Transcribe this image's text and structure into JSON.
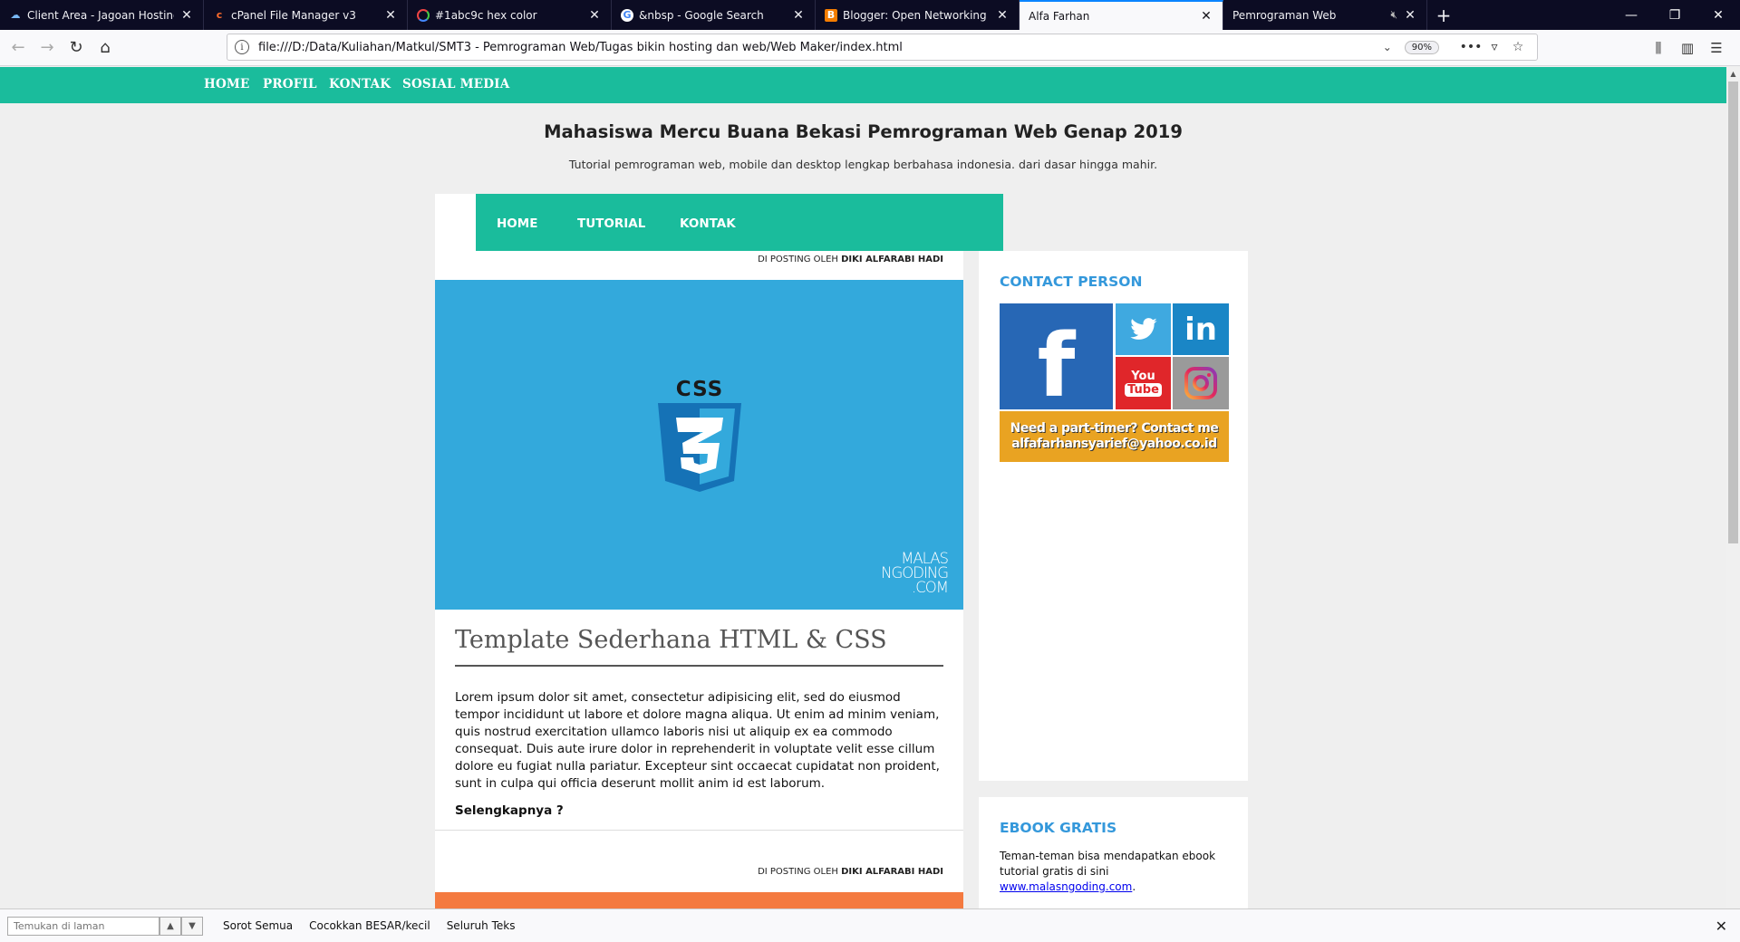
{
  "browser": {
    "tabs": [
      {
        "title": "Client Area - Jagoan Hosting Indon",
        "favicon": "cloud-icon",
        "active": false
      },
      {
        "title": "cPanel File Manager v3",
        "favicon": "cpanel-icon",
        "active": false
      },
      {
        "title": "#1abc9c hex color",
        "favicon": "color-wheel-icon",
        "active": false
      },
      {
        "title": "&nbsp - Google Search",
        "favicon": "google-icon",
        "active": false
      },
      {
        "title": "Blogger: Open Networking - Ta",
        "favicon": "blogger-icon",
        "active": false
      },
      {
        "title": "Alfa Farhan",
        "favicon": "",
        "active": true
      },
      {
        "title": "Pemrograman Web",
        "favicon": "",
        "active": false
      }
    ],
    "new_tab_label": "+",
    "url": "file:///D:/Data/Kuliahan/Matkul/SMT3 - Pemrograman Web/Tugas bikin hosting dan web/Web Maker/index.html",
    "zoom": "90%"
  },
  "page": {
    "top_nav": [
      "HOME",
      "PROFIL",
      "KONTAK",
      "SOSIAL MEDIA"
    ],
    "site_title": "Mahasiswa Mercu Buana Bekasi Pemrograman Web Genap 2019",
    "site_description": "Tutorial pemrograman web, mobile dan desktop lengkap berbahasa indonesia. dari dasar hingga mahir.",
    "main_nav": [
      "HOME",
      "TUTORIAL",
      "KONTAK"
    ],
    "posts": [
      {
        "byline_prefix": "DI POSTING OLEH",
        "author": "DIKI ALFARABI HADI",
        "image_logo_text": "CSS",
        "watermark": [
          "MALAS",
          "NGODING",
          ".COM"
        ],
        "title": "Template Sederhana HTML & CSS",
        "body": "Lorem ipsum dolor sit amet, consectetur adipisicing elit, sed do eiusmod tempor incididunt ut labore et dolore magna aliqua. Ut enim ad minim veniam, quis nostrud exercitation ullamco laboris nisi ut aliquip ex ea commodo consequat. Duis aute irure dolor in reprehenderit in voluptate velit esse cillum dolore eu fugiat nulla pariatur. Excepteur sint occaecat cupidatat non proident, sunt in culpa qui officia deserunt mollit anim id est laborum.",
        "read_more": "Selengkapnya ?"
      },
      {
        "byline_prefix": "DI POSTING OLEH",
        "author": "DIKI ALFARABI HADI"
      }
    ],
    "sidebar": {
      "contact_title": "CONTACT PERSON",
      "social": {
        "facebook": "f",
        "linkedin": "in",
        "youtube": [
          "You",
          "Tube"
        ],
        "contact_lines": [
          "Need a part-timer? Contact me",
          "alfafarhansyarief@yahoo.co.id"
        ]
      },
      "ebook_title": "EBOOK GRATIS",
      "ebook_text": "Teman-teman bisa mendapatkan ebook tutorial gratis di sini",
      "ebook_link": "www.malasngoding.com",
      "ebook_after": "."
    },
    "colors": {
      "accent": "#1abc9c",
      "link_title": "#3498db",
      "css_bg": "#33a9dc",
      "post2_bg": "#f47a40"
    }
  },
  "findbar": {
    "placeholder": "Temukan di laman",
    "options": [
      "Sorot Semua",
      "Cocokkan BESAR/kecil",
      "Seluruh Teks"
    ]
  }
}
